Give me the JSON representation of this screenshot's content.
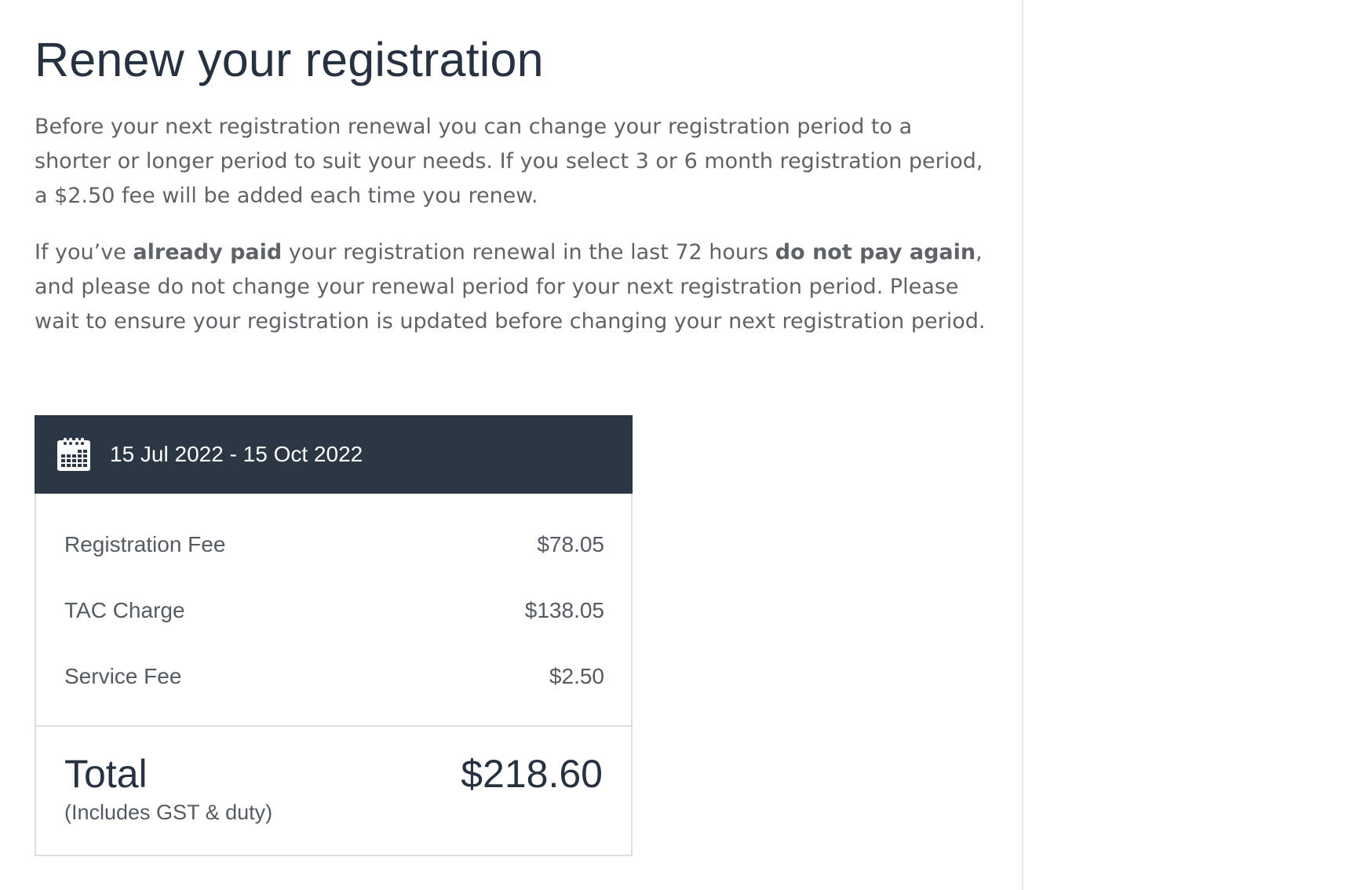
{
  "page": {
    "title": "Renew your registration",
    "intro": "Before your next registration renewal you can change your registration period to a shorter or longer period to suit your needs. If you select 3 or 6 month registration period, a $2.50 fee will be added each time you renew.",
    "notice": {
      "part1": "If you’ve ",
      "bold1": "already paid",
      "part2": " your registration renewal in the last 72 hours ",
      "bold2": "do not pay again",
      "part3": ", and please do not change your renewal period for your next registration period. Please wait to ensure your registration is updated before changing your next registration period."
    }
  },
  "summary": {
    "period": "15 Jul 2022 - 15 Oct 2022",
    "period_icon": "calendar-icon",
    "fees": [
      {
        "label": "Registration Fee",
        "amount": "$78.05"
      },
      {
        "label": "TAC Charge",
        "amount": "$138.05"
      },
      {
        "label": "Service Fee",
        "amount": "$2.50"
      }
    ],
    "total_label": "Total",
    "total_note": "(Includes GST & duty)",
    "total_amount": "$218.60"
  },
  "colors": {
    "heading": "#263241",
    "body_text": "#5f6368",
    "header_bg": "#2b3744",
    "border": "#dcdfe2"
  }
}
